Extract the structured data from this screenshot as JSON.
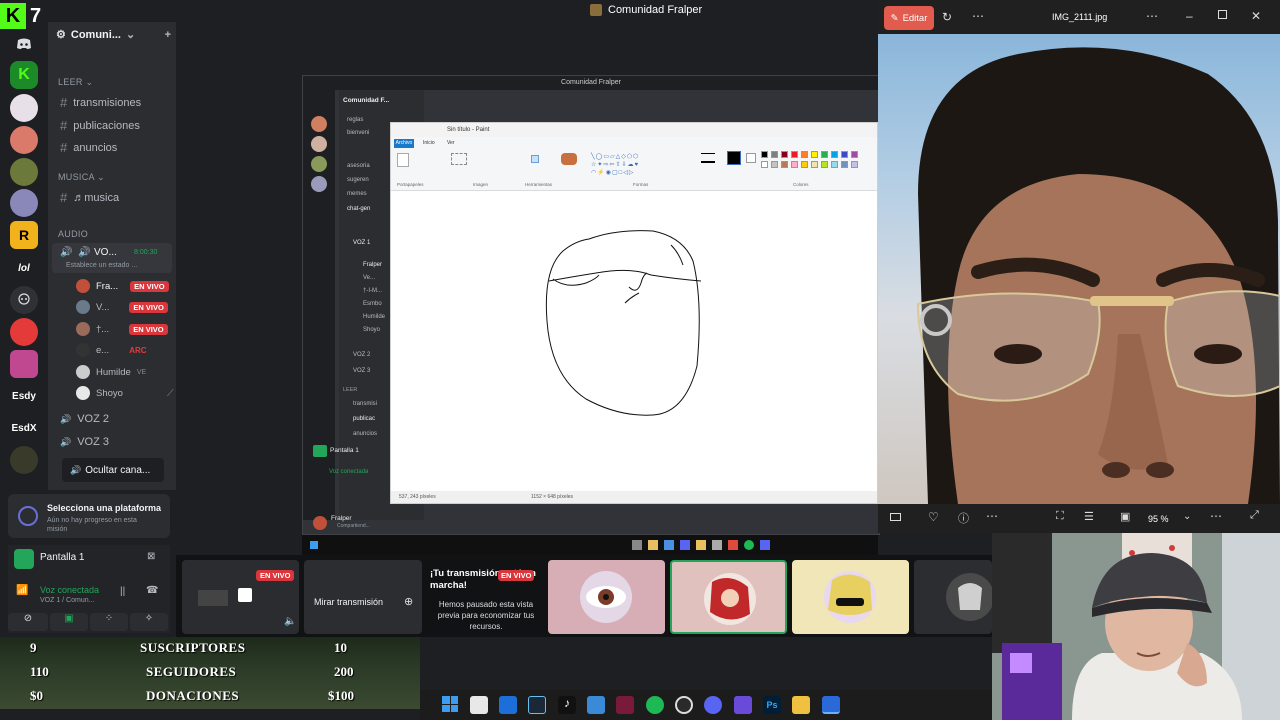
{
  "topbar": {
    "title": "Comunidad Fralper"
  },
  "kick": {
    "logo_letter": "K",
    "number": "7"
  },
  "rail": {
    "servers": [
      "discord-home",
      "kick-server",
      "anime-server-1",
      "anime-server-2",
      "anime-server-3",
      "anime-server-4",
      "rockstar-server",
      "lol-server",
      "skull-server",
      "red-server",
      "pink-server",
      "esdy-server",
      "esdx-server",
      "dark-server"
    ],
    "labels": {
      "rockstar": "R",
      "lol": "lol",
      "esdy": "Esdy",
      "esdx": "EsdX"
    }
  },
  "sidebar": {
    "server_name": "Comuni...",
    "categories": {
      "leer": "LEER",
      "musica": "MUSICA",
      "audio": "AUDIO"
    },
    "channels": [
      {
        "name": "transmisiones"
      },
      {
        "name": "publicaciones"
      },
      {
        "name": "anuncios"
      }
    ],
    "music_channel": "♬musica",
    "voice_channel": {
      "name": "VO...",
      "time": "8:00:30",
      "status": "Establece un estado ..."
    },
    "voice_users": [
      {
        "name": "Fra...",
        "badge": "EN VIVO"
      },
      {
        "name": "V...",
        "badge": "EN VIVO"
      },
      {
        "name": "†...",
        "badge": "EN VIVO"
      },
      {
        "name": "e...",
        "badge": "ARC"
      },
      {
        "name": "Humilde",
        "badge": "VE"
      },
      {
        "name": "Shoyo",
        "badge": ""
      }
    ],
    "voice_channels": [
      "VOZ 2",
      "VOZ 3"
    ],
    "hide_button": "Ocultar cana..."
  },
  "platform_card": {
    "title": "Selecciona una plataforma",
    "subtitle": "Aún no hay progreso en esta misión"
  },
  "screen_bar": {
    "screen_label": "Pantalla 1",
    "voice_status": "Voz conectada",
    "voice_detail": "VOZ 1 / Comun..."
  },
  "inner": {
    "title": "Comunidad Fralper",
    "server_name": "Comunidad F...",
    "channels": [
      "reglas",
      "bienveni",
      "asesoria",
      "sugeren",
      "memes",
      "chat-gen"
    ],
    "voice_label": "VOZ 1",
    "voice_users": [
      "Fralper",
      "Ve...",
      "†-I-M...",
      "Esmbo",
      "Humilde",
      "Shoyo"
    ],
    "voice_channels": [
      "VOZ 2",
      "VOZ 3"
    ],
    "leer": "LEER",
    "read_channels": [
      "transmisi",
      "publicac",
      "anuncios"
    ],
    "screen_label": "Pantalla 1",
    "voice_status": "Voz conectada",
    "user_name": "Fralper",
    "user_status": "Compartiend..."
  },
  "paint": {
    "title": "Sin título - Paint",
    "tabs": [
      "Archivo",
      "Inicio",
      "Ver"
    ],
    "groups": [
      "Portapapeles",
      "Imagen",
      "Herramientas",
      "Formas",
      "Colores"
    ],
    "status_left": "537, 243 píxeles",
    "status_mid": "1152 × 648 píxeles",
    "palette": [
      "#000000",
      "#7f7f7f",
      "#880015",
      "#ed1c24",
      "#ff7f27",
      "#fff200",
      "#22b14c",
      "#00a2e8",
      "#3f48cc",
      "#a349a4",
      "#ffffff",
      "#c3c3c3",
      "#b97a57",
      "#ffaec9",
      "#ffc90e",
      "#efe4b0",
      "#b5e61d",
      "#99d9ea",
      "#7092be",
      "#c8bfe7"
    ]
  },
  "viewer": {
    "edit_label": "Editar",
    "file_name": "IMG_2111.jpg",
    "zoom": "95 %"
  },
  "strip": {
    "preview_badge": "EN VIVO",
    "watch_label": "Mirar transmisión",
    "paused_title": "¡Tu transmisión está en marcha!",
    "paused_badge": "EN VIVO",
    "paused_body": "Hemos pausado esta vista previa para economizar tus recursos."
  },
  "stats": {
    "rows": [
      {
        "left": "9",
        "label": "SUSCRIPTORES",
        "right": "10"
      },
      {
        "left": "110",
        "label": "SEGUIDORES",
        "right": "200"
      },
      {
        "left": "$0",
        "label": "DONACIONES",
        "right": "$100"
      }
    ]
  },
  "taskbar": {
    "icons": [
      "windows-icon",
      "file-explorer-icon",
      "store-icon",
      "steam-icon",
      "tiktok-icon",
      "app-icon",
      "vscode-icon",
      "spotify-icon",
      "obs-icon",
      "discord-icon",
      "app-icon-2",
      "photoshop-icon",
      "folder-icon",
      "paint-icon"
    ],
    "ps_label": "Ps"
  },
  "colors": {
    "discord_bg": "#313338",
    "live_red": "#da373c",
    "kick_green": "#53fc18",
    "edit_red": "#e15b4e"
  }
}
